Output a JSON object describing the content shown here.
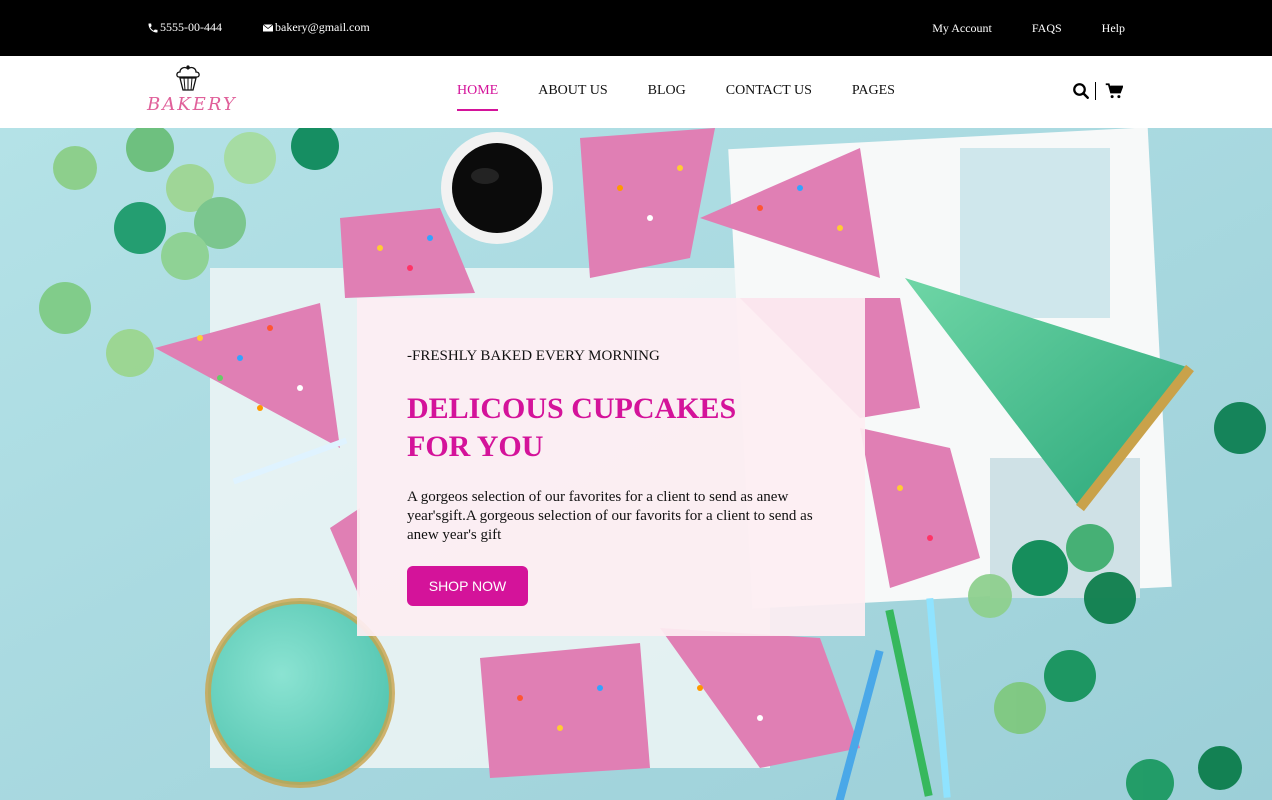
{
  "topbar": {
    "phone": "5555-00-444",
    "email": "bakery@gmail.com",
    "links": [
      "My Account",
      "FAQS",
      "Help"
    ]
  },
  "nav": {
    "logo_text": "BAKERY",
    "items": [
      "HOME",
      "ABOUT US",
      "BLOG",
      "CONTACT US",
      "PAGES"
    ],
    "active": "HOME"
  },
  "hero": {
    "kicker": "-FRESHLY BAKED EVERY MORNING",
    "title": "DELICOUS CUPCAKES FOR YOU",
    "body": "A gorgeos selection of our favorites for a client to send as anew year'sgift.A gorgeous selection of our favorits for a client to send as anew year's gift",
    "button": "SHOP NOW"
  },
  "colors": {
    "accent": "#d4139a",
    "topbar_bg": "#000000",
    "hero_bg": "#a9d9e0"
  }
}
